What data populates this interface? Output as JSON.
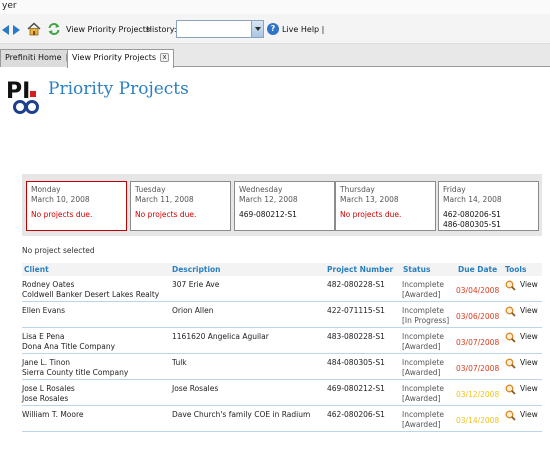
{
  "window": {
    "title_fragment": "yer"
  },
  "toolbar": {
    "view_priority_label": "View Priority Projects",
    "history_label": "History:",
    "history_value": "",
    "live_help_label": "Live Help |",
    "icons": [
      "back-arrow-icon",
      "forward-arrow-icon",
      "home-icon",
      "refresh-icon",
      "help-icon"
    ]
  },
  "tabs": [
    {
      "label": "Prefiniti Home",
      "active": false
    },
    {
      "label": "View Priority Projects",
      "active": true
    }
  ],
  "page": {
    "logo_text": "PI",
    "title": "Priority Projects",
    "accent_color": "#2a7fc0",
    "no_project_selected": "No project selected"
  },
  "days": [
    {
      "weekday": "Monday",
      "date": "March 10, 2008",
      "message": "No projects due.",
      "projects": [],
      "selected": true
    },
    {
      "weekday": "Tuesday",
      "date": "March 11, 2008",
      "message": "No projects due.",
      "projects": [],
      "selected": false
    },
    {
      "weekday": "Wednesday",
      "date": "March 12, 2008",
      "message": "",
      "projects": [
        "469-080212-S1"
      ],
      "selected": false
    },
    {
      "weekday": "Thursday",
      "date": "March 13, 2008",
      "message": "No projects due.",
      "projects": [],
      "selected": false
    },
    {
      "weekday": "Friday",
      "date": "March 14, 2008",
      "message": "",
      "projects": [
        "462-080206-S1",
        "486-080305-S1"
      ],
      "selected": false
    }
  ],
  "table": {
    "headers": {
      "client": "Client",
      "description": "Description",
      "project_number": "Project Number",
      "status": "Status",
      "due_date": "Due Date",
      "tools": "Tools"
    },
    "rows": [
      {
        "client": "Rodney Oates",
        "client2": "Coldwell Banker Desert Lakes Realty",
        "description": "307 Erie Ave",
        "project_number": "482-080228-S1",
        "status": "Incomplete",
        "status2": "[Awarded]",
        "due_date": "03/04/2008",
        "due_color": "red",
        "tool": "View"
      },
      {
        "client": "Ellen Evans",
        "client2": "",
        "description": "Orion Allen",
        "project_number": "422-071115-S1",
        "status": "Incomplete",
        "status2": "[In Progress]",
        "due_date": "03/06/2008",
        "due_color": "red",
        "tool": "View"
      },
      {
        "client": "Lisa E Pena",
        "client2": "Dona Ana Title Company",
        "description": "1161620 Angelica Aguilar",
        "project_number": "483-080228-S1",
        "status": "Incomplete",
        "status2": "[Awarded]",
        "due_date": "03/07/2008",
        "due_color": "red",
        "tool": "View"
      },
      {
        "client": "Jane L. Tinon",
        "client2": "Sierra County title Company",
        "description": "Tulk",
        "project_number": "484-080305-S1",
        "status": "Incomplete",
        "status2": "[Awarded]",
        "due_date": "03/07/2008",
        "due_color": "red",
        "tool": "View"
      },
      {
        "client": "Jose L Rosales",
        "client2": "Jose Rosales",
        "description": "Jose Rosales",
        "project_number": "469-080212-S1",
        "status": "Incomplete",
        "status2": "[Awarded]",
        "due_date": "03/12/2008",
        "due_color": "yellow",
        "tool": "View"
      },
      {
        "client": "William T. Moore",
        "client2": "",
        "description": "Dave Church's family COE in Radium",
        "project_number": "462-080206-S1",
        "status": "Incomplete",
        "status2": "[Awarded]",
        "due_date": "03/14/2008",
        "due_color": "yellow",
        "tool": "View"
      }
    ]
  }
}
